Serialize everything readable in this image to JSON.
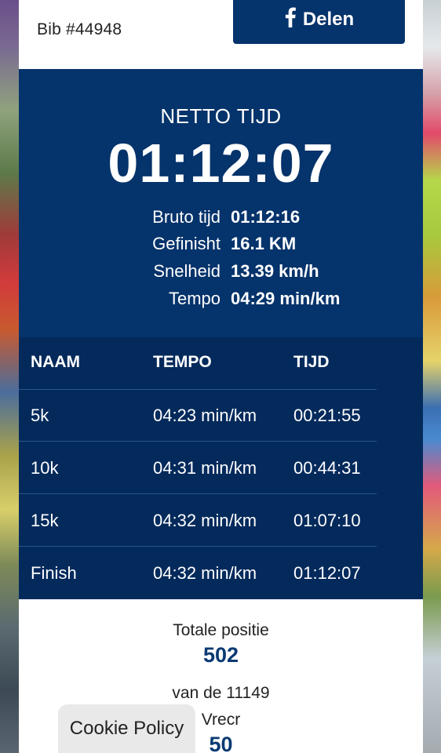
{
  "header": {
    "bib": "Bib #44948",
    "share_label": "Delen",
    "share_icon": "facebook-icon"
  },
  "result": {
    "net_label": "NETTO TIJD",
    "net_time": "01:12:07",
    "stats": [
      {
        "label": "Bruto tijd",
        "value": "01:12:16"
      },
      {
        "label": "Gefinisht",
        "value": "16.1 KM"
      },
      {
        "label": "Snelheid",
        "value": "13.39 km/h"
      },
      {
        "label": "Tempo",
        "value": "04:29 min/km"
      }
    ]
  },
  "splits": {
    "headers": [
      "NAAM",
      "TEMPO",
      "TIJD"
    ],
    "rows": [
      {
        "name": "5k",
        "tempo": "04:23 min/km",
        "time": "00:21:55"
      },
      {
        "name": "10k",
        "tempo": "04:31 min/km",
        "time": "00:44:31"
      },
      {
        "name": "15k",
        "tempo": "04:32 min/km",
        "time": "01:07:10"
      },
      {
        "name": "Finish",
        "tempo": "04:32 min/km",
        "time": "01:12:07"
      }
    ]
  },
  "position": {
    "total_label": "Totale positie",
    "total_value": "502",
    "total_of": "van de 11149",
    "category_label": "Vrecr",
    "category_value": "50"
  },
  "cookie": {
    "label": "Cookie Policy"
  },
  "colors": {
    "primary": "#05336b",
    "table": "#042a5c",
    "value_text": "#0a3a73"
  }
}
